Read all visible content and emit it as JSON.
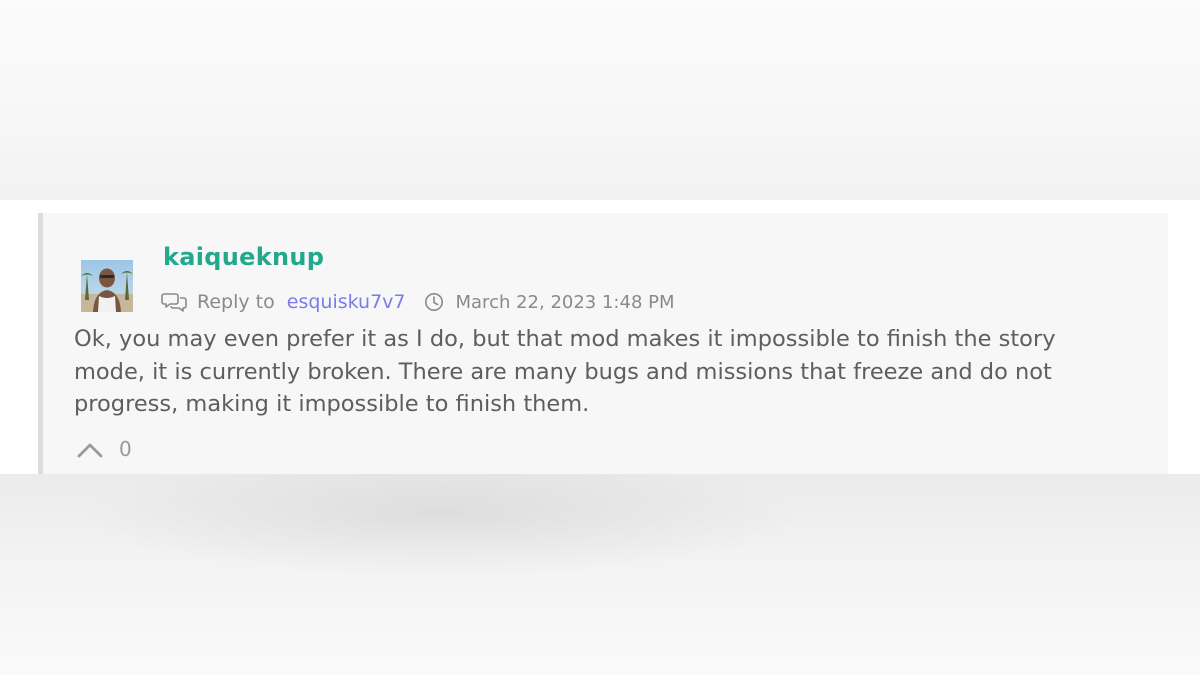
{
  "comment": {
    "author": "kaiqueknup",
    "reply_label": "Reply to",
    "reply_to": "esquisku7v7",
    "timestamp": "March 22, 2023 1:48 PM",
    "body": "Ok, you may even prefer it as I do, but that mod makes it impossible to finish the story mode, it is currently broken. There are many bugs and missions that freeze and do not progress, making it impossible to finish them.",
    "votes": "0"
  },
  "icons": {
    "reply": "reply-icon",
    "clock": "clock-icon",
    "upvote": "chevron-up-icon"
  },
  "colors": {
    "author": "#23a88c",
    "reply_link": "#7c7ce8",
    "body_text": "#5e5e5e",
    "meta_text": "#8a8a8a",
    "card_background": "#f7f7f7",
    "card_border": "#dcdcdc"
  }
}
